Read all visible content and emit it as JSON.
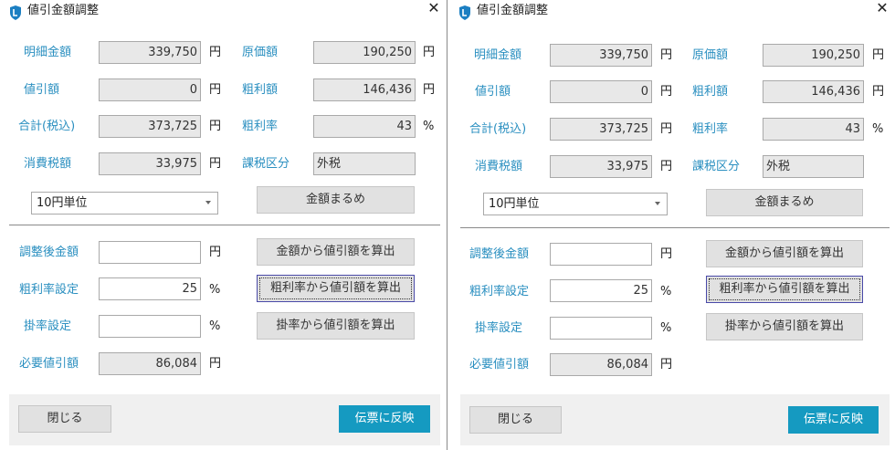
{
  "dialogs": [
    {
      "title": "値引金額調整",
      "close_glyph": "✕",
      "fields": {
        "meisai_label": "明細金額",
        "meisai_value": "339,750",
        "meisai_unit": "円",
        "genka_label": "原価額",
        "genka_value": "190,250",
        "genka_unit": "円",
        "nebiki_label": "値引額",
        "nebiki_value": "0",
        "nebiki_unit": "円",
        "arari_label": "粗利額",
        "arari_value": "146,436",
        "arari_unit": "円",
        "gokei_label": "合計(税込)",
        "gokei_value": "373,725",
        "gokei_unit": "円",
        "ararirate_label": "粗利率",
        "ararirate_value": "43",
        "ararirate_unit": "%",
        "shohizei_label": "消費税額",
        "shohizei_value": "33,975",
        "shohizei_unit": "円",
        "kazei_label": "課税区分",
        "kazei_value": "外税"
      },
      "rounding_select": "10円単位",
      "round_button": "金額まるめ",
      "adjust": {
        "chosei_label": "調整後金額",
        "chosei_value": "",
        "chosei_unit": "円",
        "arari_setting_label": "粗利率設定",
        "arari_setting_value": "25",
        "arari_setting_unit": "%",
        "kakeritsu_label": "掛率設定",
        "kakeritsu_value": "",
        "kakeritsu_unit": "%",
        "hitsuyo_label": "必要値引額",
        "hitsuyo_value": "86,084",
        "hitsuyo_unit": "円",
        "btn_from_amount": "金額から値引額を算出",
        "btn_from_arari": "粗利率から値引額を算出",
        "btn_from_kakeritsu": "掛率から値引額を算出"
      },
      "footer": {
        "close_label": "閉じる",
        "apply_label": "伝票に反映"
      }
    },
    {
      "title": "値引金額調整",
      "close_glyph": "✕",
      "fields": {
        "meisai_label": "明細金額",
        "meisai_value": "339,750",
        "meisai_unit": "円",
        "genka_label": "原価額",
        "genka_value": "190,250",
        "genka_unit": "円",
        "nebiki_label": "値引額",
        "nebiki_value": "0",
        "nebiki_unit": "円",
        "arari_label": "粗利額",
        "arari_value": "146,436",
        "arari_unit": "円",
        "gokei_label": "合計(税込)",
        "gokei_value": "373,725",
        "gokei_unit": "円",
        "ararirate_label": "粗利率",
        "ararirate_value": "43",
        "ararirate_unit": "%",
        "shohizei_label": "消費税額",
        "shohizei_value": "33,975",
        "shohizei_unit": "円",
        "kazei_label": "課税区分",
        "kazei_value": "外税"
      },
      "rounding_select": "10円単位",
      "round_button": "金額まるめ",
      "adjust": {
        "chosei_label": "調整後金額",
        "chosei_value": "",
        "chosei_unit": "円",
        "arari_setting_label": "粗利率設定",
        "arari_setting_value": "25",
        "arari_setting_unit": "%",
        "kakeritsu_label": "掛率設定",
        "kakeritsu_value": "",
        "kakeritsu_unit": "%",
        "hitsuyo_label": "必要値引額",
        "hitsuyo_value": "86,084",
        "hitsuyo_unit": "円",
        "btn_from_amount": "金額から値引額を算出",
        "btn_from_arari": "粗利率から値引額を算出",
        "btn_from_kakeritsu": "掛率から値引額を算出"
      },
      "footer": {
        "close_label": "閉じる",
        "apply_label": "伝票に反映"
      }
    }
  ],
  "colors": {
    "label_blue": "#2a8fc0",
    "primary_button": "#159ac1",
    "readonly_bg": "#e8e8e8"
  },
  "icons": {
    "app_icon": "shield-icon",
    "close_icon": "close-icon",
    "dropdown_icon": "chevron-down-icon"
  }
}
